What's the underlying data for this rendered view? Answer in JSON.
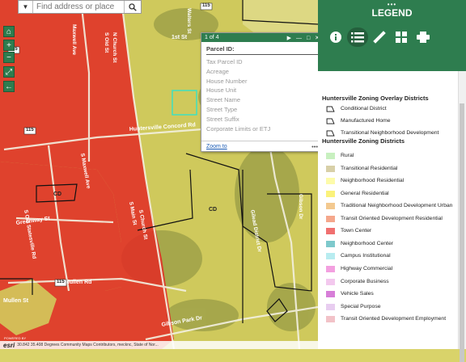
{
  "search": {
    "placeholder": "Find address or place",
    "dropdown_icon": "caret-down-icon",
    "search_icon": "magnifier-icon"
  },
  "map_controls": [
    {
      "name": "home-icon",
      "glyph": "⌂"
    },
    {
      "name": "zoom-in-icon",
      "glyph": "+"
    },
    {
      "name": "zoom-out-icon",
      "glyph": "−"
    },
    {
      "name": "fullscreen-icon",
      "glyph": "⤢"
    },
    {
      "name": "back-arrow-icon",
      "glyph": "←"
    }
  ],
  "map": {
    "cd_labels": [
      "CD",
      "CD"
    ],
    "shields": [
      "115",
      "115",
      "115",
      "115"
    ]
  },
  "popup": {
    "counter": "1 of 4",
    "title": "Parcel ID:",
    "fields": [
      "Tax Parcel ID",
      "Acreage",
      "House Number",
      "House Unit",
      "Street Name",
      "Street Type",
      "Street Suffix",
      "Corporate Limits or ETJ"
    ],
    "zoom_link": "Zoom to",
    "more": "•••"
  },
  "panel": {
    "grip": "•••",
    "title": "LEGEND",
    "tools": [
      {
        "name": "about-icon",
        "glyph": "i"
      },
      {
        "name": "legend-list-icon",
        "glyph": "☰"
      },
      {
        "name": "measure-ruler-icon",
        "glyph": "✎"
      },
      {
        "name": "basemap-gallery-icon",
        "glyph": "▦"
      },
      {
        "name": "print-icon",
        "glyph": "⎙"
      }
    ],
    "overlay_title": "Huntersville Zoning Overlay Districts",
    "overlay_items": [
      {
        "label": "Conditional District"
      },
      {
        "label": "Manufactured Home"
      },
      {
        "label": "Transitional Neighborhood Development"
      }
    ],
    "districts_title": "Huntersville Zoning Districts",
    "district_items": [
      {
        "label": "Rural",
        "color": "#c8f0c0"
      },
      {
        "label": "Transitional Residential",
        "color": "#d8d0a8"
      },
      {
        "label": "Neighborhood Residential",
        "color": "#fdfbaa"
      },
      {
        "label": "General Residential",
        "color": "#fbf27b"
      },
      {
        "label": "Traditional Neighborhood Development Urban",
        "color": "#f3c990"
      },
      {
        "label": "Transit Oriented Development Residential",
        "color": "#f5a78c"
      },
      {
        "label": "Town Center",
        "color": "#f07070"
      },
      {
        "label": "Neighborhood Center",
        "color": "#7ec9cc"
      },
      {
        "label": "Campus Institutional",
        "color": "#b8ecf0"
      },
      {
        "label": "Highway Commercial",
        "color": "#f3a0e0"
      },
      {
        "label": "Corporate Business",
        "color": "#f3c8ee"
      },
      {
        "label": "Vehicle Sales",
        "color": "#d77ed8"
      },
      {
        "label": "Special Purpose",
        "color": "#e8cdf0"
      },
      {
        "label": "Transit Oriented Development Employment",
        "color": "#f2c2c8"
      }
    ]
  },
  "attribution": {
    "powered": "POWERED BY",
    "logo": "esri",
    "text": "30.842  35.408 Degrees  Community Maps Contributors, mecknc, State of Nor..."
  },
  "colors": {
    "accent": "#2e7d4f",
    "town_center": "#e01f1f",
    "general_residential": "#d9d36a"
  }
}
